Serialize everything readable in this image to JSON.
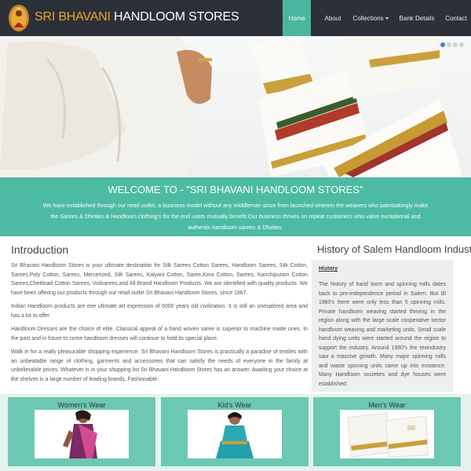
{
  "brand": {
    "part1": "SRI BHAVANI",
    "part2": "HANDLOOM STORES"
  },
  "nav": {
    "home": "Home",
    "about": "About",
    "collections": "Collections",
    "bank": "Bank Details",
    "contact": "Contact",
    "active": "Home"
  },
  "slider": {
    "slides": 4,
    "active_index": 0
  },
  "welcome": {
    "title": "WELCOME TO - \"SRI BHAVANI HANDLOOM STORES\"",
    "text": "We have established through our retail outlet, a business model without any middleman since from launched wherein the weavers who painstakingly make the Sarees & Dhoties & Handloom clothing's for the end users mutually benefit.Our business thrives on repeat customers who value exceptional and authentic handloom sarees & Dhoties."
  },
  "intro": {
    "title": "Introduction",
    "paragraphs": [
      "Sri Bhavani Handloom Stores is your ultimate destination for Silk Sarees Cotton Sarees, Handloom Sarees, Silk Cotton, Sarees,Poly Cotton, Sarees, Mercerized, Silk Sarees, Kalyani Cotton, Saree,Kora Cotton, Sarees, Kanchipuram Cotton Sarees,Chettinad Cotton Sarees, Voilsarees,and All Brand Handloom Products. We are identified with quality products. We have been offering our products through our retail outlet Sri Bhavani Handloom Stores, since 1967.",
      "Indian Handloom products are one ultimate art expression of 5000 years old civilization. It is still an unexplored area and has a lot to offer.",
      "Handloom Dresses are the choice of elite. Classical appeal of a hand woven saree is superior to machine made ones. In the past and in future to come handloom dresses will continue to hold its special place.",
      "Walk in for a really pleasurable shopping experience. Sri Bhavani Handloom Stores is practically a paradise of textiles with an unbeatable range of clothing, garments and accessories that can satisfy the needs of everyone in the family at unbelievable prices. Whatever is in your shopping list Sri Bhavani Handloom Stores has an answer. Awaiting your choice at the shelves is a large number of leading brands, Fashionable."
    ]
  },
  "history": {
    "title": "History of Salem Handloom Industry",
    "heading": "History",
    "text": "The history of hand loom and spinning mills dates back to pre-independence period in Salem. But till 1960's there were only less than 5 spinning mills. Private handloom weaving started thriving in the region along with the large scale cooperative sector handloom weaving and marketing units. Small scale hand dying units were started around the region to support the industry. Around 1980's the texindustry saw a massive growth. Many major spinning mills and waste spinning units came up into existence. Many Handloom societies and dye houses were established."
  },
  "categories": {
    "women": "Women's Wear",
    "kids": "Kid's Wear",
    "men": "Men's Wear"
  },
  "colors": {
    "navbar": "#2b3039",
    "accent": "#4dbba3",
    "brand_orange": "#f0a52c",
    "card": "#6cc8b2"
  }
}
